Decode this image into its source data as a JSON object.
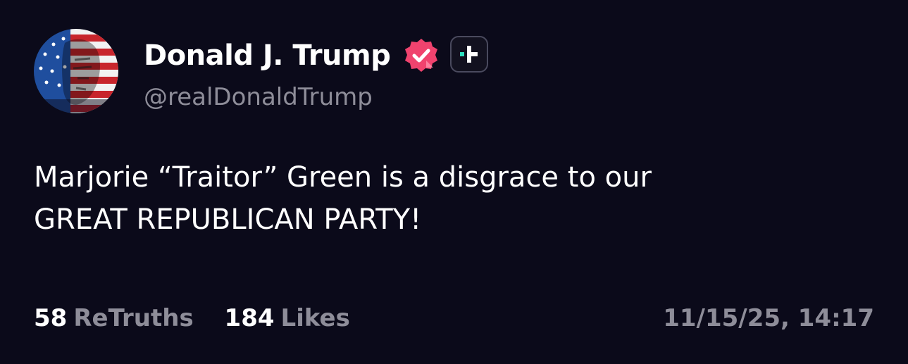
{
  "author": {
    "display_name": "Donald J. Trump",
    "handle": "@realDonaldTrump",
    "avatar_icon": "flag-portrait-avatar",
    "verified_icon": "verified-badge-icon",
    "verified_color": "#f0436e",
    "subscription_icon": "plus-badge-icon",
    "subscription_color": "#2de0c0"
  },
  "post": {
    "text": "Marjorie “Traitor” Green is a disgrace to our\nGREAT REPUBLICAN PARTY!"
  },
  "stats": {
    "retruths_count": "58",
    "retruths_label": "ReTruths",
    "likes_count": "184",
    "likes_label": "Likes"
  },
  "timestamp": "11/15/25, 14:17",
  "colors": {
    "background": "#0b0a1a",
    "text_primary": "#ffffff",
    "text_secondary": "#8e8d99"
  }
}
